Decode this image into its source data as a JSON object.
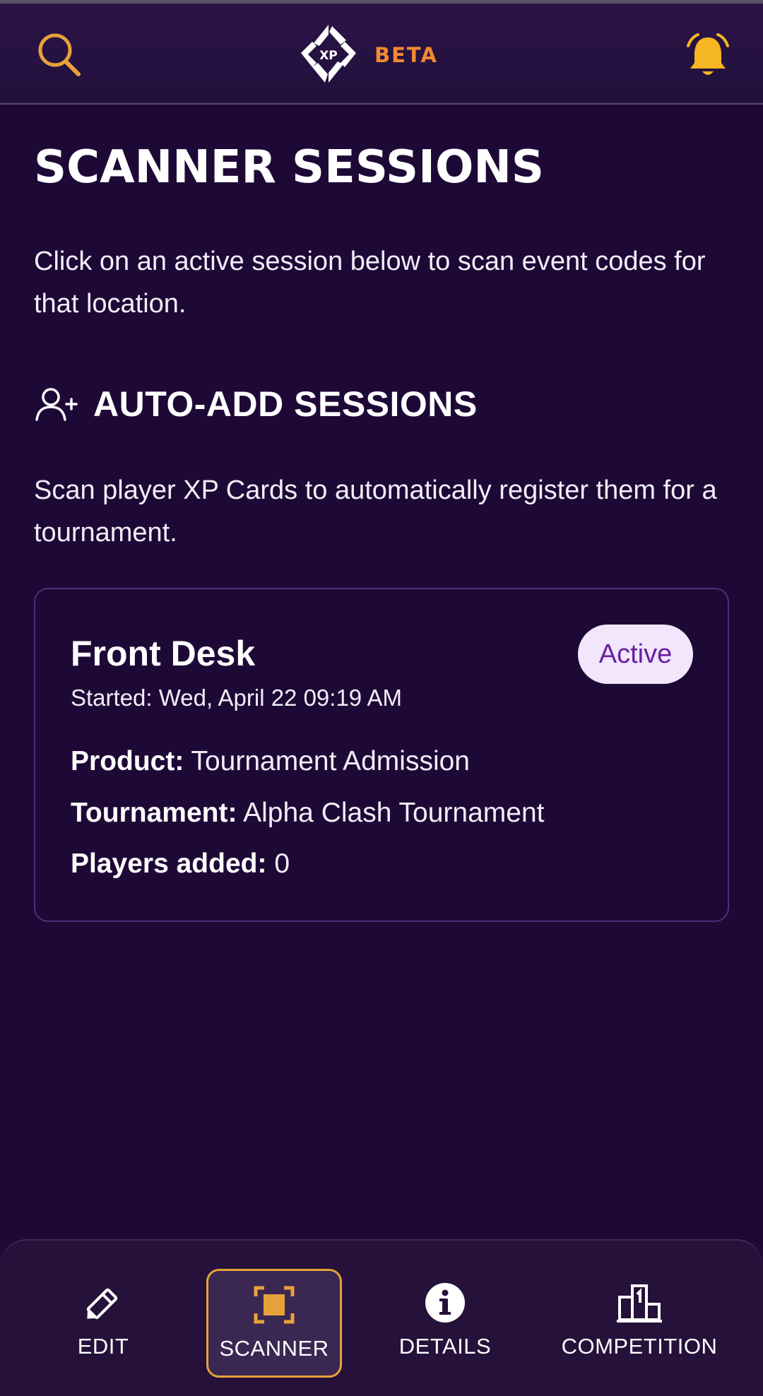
{
  "header": {
    "logo_text": "XP",
    "beta_label": "BETA",
    "search_icon": "search-icon",
    "bell_icon": "bell-icon"
  },
  "main": {
    "title": "SCANNER SESSIONS",
    "intro": "Click on an active session below to scan event codes for that location.",
    "section": {
      "icon": "user-plus-icon",
      "title": "AUTO-ADD SESSIONS",
      "description": "Scan player XP Cards to automatically register them for a tournament."
    },
    "session": {
      "name": "Front Desk",
      "status": "Active",
      "started": "Started: Wed, April 22 09:19 AM",
      "product_label": "Product:",
      "product_value": "Tournament Admission",
      "tournament_label": "Tournament:",
      "tournament_value": "Alpha Clash Tournament",
      "players_label": "Players added:",
      "players_value": "0"
    }
  },
  "bottom_nav": {
    "items": [
      {
        "label": "EDIT",
        "icon": "pencil-icon"
      },
      {
        "label": "SCANNER",
        "icon": "scanner-icon",
        "active": true
      },
      {
        "label": "DETAILS",
        "icon": "info-icon"
      },
      {
        "label": "COMPETITION",
        "icon": "podium-icon"
      }
    ]
  },
  "colors": {
    "background": "#1e0936",
    "accent_orange": "#f08a33",
    "accent_gold": "#e7a23a",
    "badge_bg": "#f1e6fb",
    "badge_text": "#6a1fa0"
  }
}
